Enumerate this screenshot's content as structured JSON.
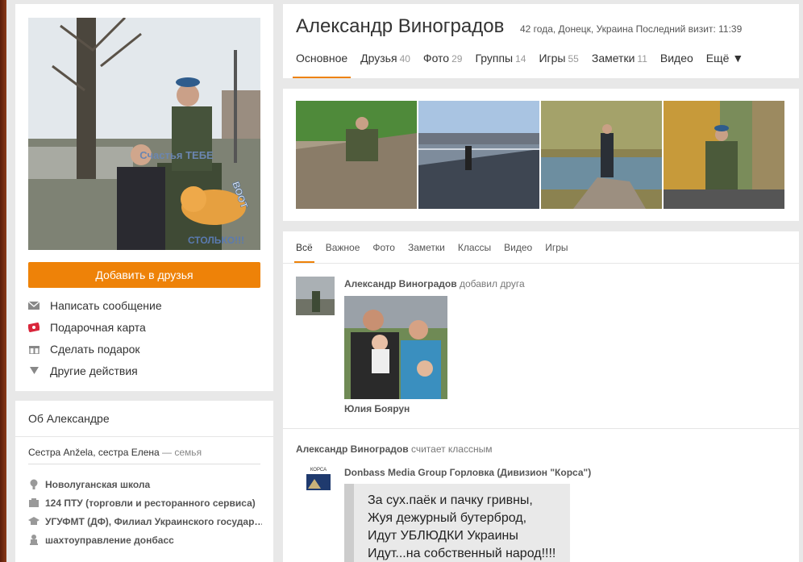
{
  "profile": {
    "name": "Александр Виноградов",
    "meta": "42 года, Донецк, Украина  Последний визит: 11:39",
    "avatar_caption": [
      "Счастья ТЕБЕ",
      "ВООТ",
      "СТОЛЬКО!!!"
    ]
  },
  "tabs": [
    {
      "label": "Основное",
      "count": ""
    },
    {
      "label": "Друзья",
      "count": "40"
    },
    {
      "label": "Фото",
      "count": "29"
    },
    {
      "label": "Группы",
      "count": "14"
    },
    {
      "label": "Игры",
      "count": "55"
    },
    {
      "label": "Заметки",
      "count": "11"
    },
    {
      "label": "Видео",
      "count": ""
    },
    {
      "label": "Ещё ▼",
      "count": ""
    }
  ],
  "left": {
    "add_friend": "Добавить в друзья",
    "actions": [
      {
        "label": "Написать сообщение",
        "icon": "message-icon"
      },
      {
        "label": "Подарочная карта",
        "icon": "gift-card-icon"
      },
      {
        "label": "Сделать подарок",
        "icon": "gift-icon"
      },
      {
        "label": "Другие действия",
        "icon": "triangle-down-icon"
      }
    ]
  },
  "about": {
    "title": "Об Александре",
    "family_text": "Сестра Anžela, сестра Елена",
    "family_suffix": " — семья",
    "items": [
      {
        "label": "Новолуганская школа",
        "icon": "school-icon"
      },
      {
        "label": "124 ПТУ (торговли и ресторанного сервиса)",
        "icon": "college-icon"
      },
      {
        "label": "УГУФМТ (ДФ), Филиал Украинского государ…",
        "icon": "university-icon"
      },
      {
        "label": "шахтоуправление донбасс",
        "icon": "work-icon"
      }
    ]
  },
  "feed": {
    "filters": [
      "Всё",
      "Важное",
      "Фото",
      "Заметки",
      "Классы",
      "Видео",
      "Игры"
    ],
    "event1": {
      "author": "Александр Виноградов",
      "action": " добавил друга",
      "friend": "Юлия Боярун"
    },
    "event2": {
      "author": "Александр Виноградов",
      "action": " считает классным",
      "group": "Donbass Media Group Горловка (Дивизион \"Корса\")",
      "logo_text": "КОРСА",
      "poem": [
        "За сух.паёк и пачку гривны,",
        "Жуя дежурный бутерброд,",
        "Идут УБЛЮДКИ Украины",
        "Идут...на собственный народ!!!!"
      ]
    }
  },
  "colors": {
    "accent": "#ee8208",
    "background": "#e8e8e8"
  }
}
